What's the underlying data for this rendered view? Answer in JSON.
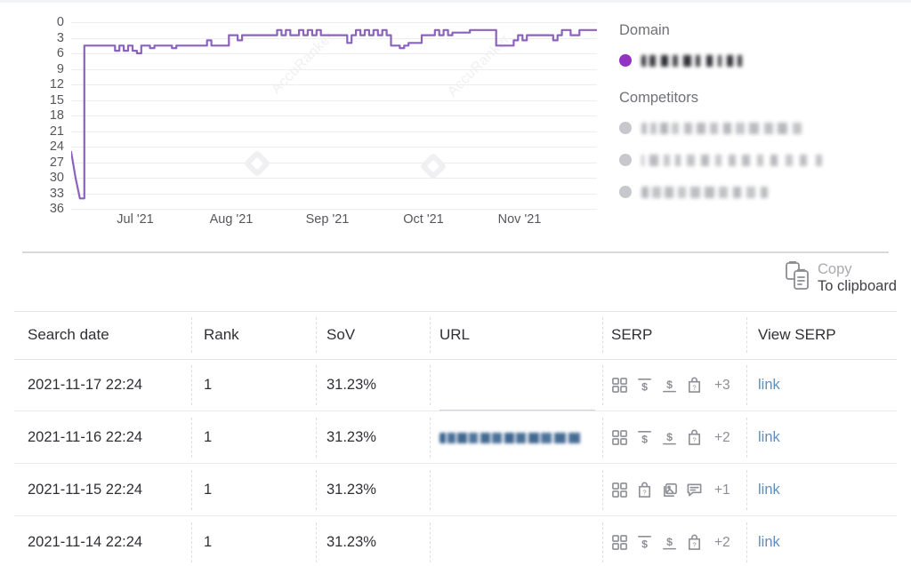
{
  "chart_data": {
    "type": "line",
    "title": "",
    "xlabel": "",
    "ylabel": "",
    "grid": true,
    "legend_position": "right",
    "y_inverted": true,
    "ylim": [
      0,
      36
    ],
    "y_ticks": [
      "0",
      "3",
      "6",
      "9",
      "12",
      "15",
      "18",
      "21",
      "24",
      "27",
      "30",
      "33",
      "36"
    ],
    "x_ticks": [
      "Jul '21",
      "Aug '21",
      "Sep '21",
      "Oct '21",
      "Nov '21"
    ],
    "series": [
      {
        "name": "domain-rank",
        "color": "#8b63be",
        "values": [
          25,
          30,
          34,
          4.5,
          4.5,
          4.5,
          4.5,
          4.5,
          4.5,
          4.5,
          5.5,
          4.5,
          5.5,
          4.5,
          5.5,
          6,
          4.5,
          4.5,
          5,
          4.5,
          4.5,
          4.5,
          4.5,
          5,
          4.5,
          4.5,
          4.5,
          4.5,
          4.5,
          4.5,
          4.5,
          3.5,
          4.5,
          4.5,
          4.5,
          4.5,
          2.5,
          2.5,
          3.5,
          2.5,
          2.5,
          2.5,
          2.5,
          2.5,
          2.5,
          2.5,
          2.5,
          1.5,
          2.5,
          1.5,
          2.5,
          2.5,
          1.5,
          2.5,
          1.5,
          2.5,
          1.5,
          2.5,
          2.5,
          2.5,
          2.5,
          2.5,
          2.5,
          4,
          2.5,
          1.5,
          2.5,
          1.5,
          2.5,
          1.5,
          2.5,
          1.5,
          2.5,
          4.5,
          4.5,
          5,
          4.5,
          4,
          4,
          4,
          2.5,
          2.5,
          2.5,
          1.5,
          2.5,
          1.5,
          2.5,
          2,
          2,
          2,
          2,
          1.5,
          1.5,
          1.5,
          1.5,
          1.5,
          1.5,
          4.5,
          4.5,
          4.5,
          4.5,
          3.5,
          2.5,
          3.5,
          2.5,
          2.5,
          2.5,
          2.5,
          2.5,
          2.5,
          3.5,
          2.5,
          1.5,
          1.5,
          2.5,
          2.5,
          1.5,
          1.5,
          1.5,
          1.5,
          1.5
        ]
      }
    ]
  },
  "legend": {
    "domain_title": "Domain",
    "competitors_title": "Competitors",
    "domain_color": "#9333c4",
    "competitor_color": "#c7c8cb",
    "domain_entry_redacted": true,
    "competitor_entries_redacted": [
      true,
      true,
      true
    ]
  },
  "watermark": {
    "text": "AccuRanker"
  },
  "toolbar": {
    "copy_line1": "Copy",
    "copy_line2": "To clipboard",
    "copy_icon": "clipboard-icon"
  },
  "table": {
    "columns": [
      "Search date",
      "Rank",
      "SoV",
      "URL",
      "SERP",
      "View SERP"
    ],
    "rows": [
      {
        "search_date": "2021-11-17 22:24",
        "rank": "1",
        "sov": "31.23%",
        "url_redacted": true,
        "serp_icons": [
          "grid-icon",
          "ads-top-icon",
          "ads-bottom-icon",
          "shopping-question-icon"
        ],
        "serp_more": "+3",
        "view_serp": "link"
      },
      {
        "search_date": "2021-11-16 22:24",
        "rank": "1",
        "sov": "31.23%",
        "url_redacted": true,
        "serp_icons": [
          "grid-icon",
          "ads-top-icon",
          "ads-bottom-icon",
          "shopping-question-icon"
        ],
        "serp_more": "+2",
        "view_serp": "link"
      },
      {
        "search_date": "2021-11-15 22:24",
        "rank": "1",
        "sov": "31.23%",
        "url_redacted": true,
        "serp_icons": [
          "grid-icon",
          "shopping-question-icon",
          "image-stack-icon",
          "comment-icon"
        ],
        "serp_more": "+1",
        "view_serp": "link"
      },
      {
        "search_date": "2021-11-14 22:24",
        "rank": "1",
        "sov": "31.23%",
        "url_redacted": true,
        "serp_icons": [
          "grid-icon",
          "ads-top-icon",
          "ads-bottom-icon",
          "shopping-question-icon"
        ],
        "serp_more": "+2",
        "view_serp": "link"
      }
    ]
  }
}
